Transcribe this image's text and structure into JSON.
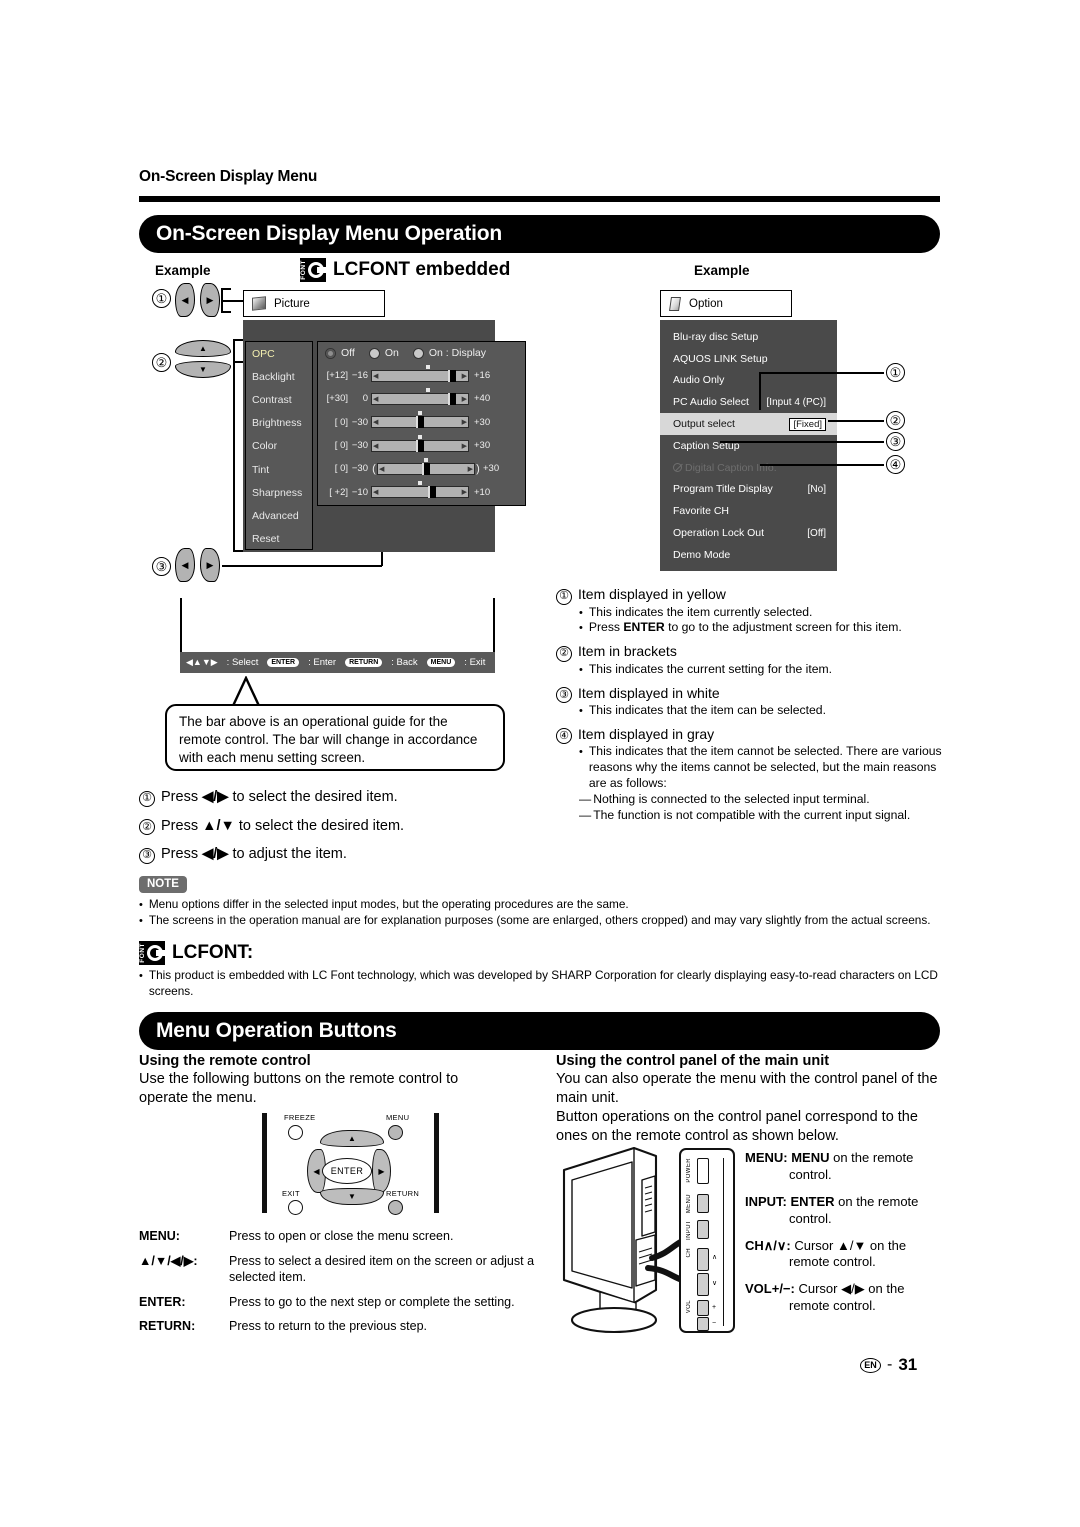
{
  "header": {
    "running_head": "On-Screen Display Menu",
    "band_osd": "On-Screen Display Menu Operation",
    "band_mob": "Menu Operation Buttons"
  },
  "labels": {
    "example_left": "Example",
    "example_right": "Example",
    "lcfont_embedded": "LCFONT embedded",
    "lcfont_mark_text": "FONT",
    "lcfont_heading": "LCFONT:"
  },
  "picture_menu": {
    "tab_label": "Picture",
    "items": [
      {
        "label": "OPC",
        "selected": true
      },
      {
        "label": "Backlight",
        "selected": false
      },
      {
        "label": "Contrast",
        "selected": false
      },
      {
        "label": "Brightness",
        "selected": false
      },
      {
        "label": "Color",
        "selected": false
      },
      {
        "label": "Tint",
        "selected": false
      },
      {
        "label": "Sharpness",
        "selected": false
      },
      {
        "label": "Advanced",
        "selected": false
      },
      {
        "label": "Reset",
        "selected": false
      }
    ],
    "opc_options": [
      {
        "label": "Off",
        "state": "on"
      },
      {
        "label": "On",
        "state": "off"
      },
      {
        "label": "On : Display",
        "state": "off"
      }
    ],
    "sliders": [
      {
        "name": "Backlight",
        "current": "[+12]",
        "min": "−16",
        "max": "+16",
        "pos": 87,
        "paren": false
      },
      {
        "name": "Contrast",
        "current": "[+30]",
        "min": "0",
        "max": "+40",
        "pos": 87,
        "paren": false
      },
      {
        "name": "Brightness",
        "current": "[  0]",
        "min": "−30",
        "max": "+30",
        "pos": 50,
        "paren": false
      },
      {
        "name": "Color",
        "current": "[  0]",
        "min": "−30",
        "max": "+30",
        "pos": 50,
        "paren": false
      },
      {
        "name": "Tint",
        "current": "[  0]",
        "min": "−30",
        "max": "+30",
        "pos": 50,
        "paren": true
      },
      {
        "name": "Sharpness",
        "current": "[ +2]",
        "min": "−10",
        "max": "+10",
        "pos": 62,
        "paren": false
      }
    ]
  },
  "guide_bar": {
    "select_label": ": Select",
    "enter_key": "ENTER",
    "enter_label": ": Enter",
    "return_key": "RETURN",
    "return_label": ": Back",
    "menu_key": "MENU",
    "menu_label": ": Exit"
  },
  "balloon": "The bar above is an operational guide for the remote control. The bar will change in accordance with each menu setting screen.",
  "press_list": [
    {
      "num": "①",
      "text_before": "Press ",
      "keys": "◀/▶",
      "text_after": " to select the desired item."
    },
    {
      "num": "②",
      "text_before": "Press ",
      "keys": "▲/▼",
      "text_after": " to select the desired item."
    },
    {
      "num": "③",
      "text_before": "Press ",
      "keys": "◀/▶",
      "text_after": " to adjust the item."
    }
  ],
  "note": {
    "badge": "NOTE",
    "items": [
      "Menu options differ in the selected input modes, but the operating procedures are the same.",
      "The screens in the operation manual are for explanation purposes (some are enlarged, others cropped) and may vary slightly from the actual screens."
    ]
  },
  "lcfont_note": "This product is embedded with LC Font technology, which was developed by SHARP Corporation for clearly displaying easy-to-read characters on LCD screens.",
  "option_menu": {
    "tab_label": "Option",
    "items": [
      {
        "label": "Blu-ray disc Setup",
        "value": "",
        "style": "normal"
      },
      {
        "label": "AQUOS LINK Setup",
        "value": "",
        "style": "normal"
      },
      {
        "label": "Audio Only",
        "value": "",
        "style": "normal"
      },
      {
        "label": "PC Audio Select",
        "value": "[Input 4 (PC)]",
        "style": "normal"
      },
      {
        "label": "Output select",
        "value": "[Fixed]",
        "style": "selected"
      },
      {
        "label": "Caption Setup",
        "value": "",
        "style": "normal"
      },
      {
        "label": "Digital Caption Info.",
        "value": "",
        "style": "disabled"
      },
      {
        "label": "Program Title Display",
        "value": "[No]",
        "style": "normal"
      },
      {
        "label": "Favorite CH",
        "value": "",
        "style": "normal"
      },
      {
        "label": "Operation Lock Out",
        "value": "[Off]",
        "style": "normal"
      },
      {
        "label": "Demo Mode",
        "value": "",
        "style": "normal"
      }
    ],
    "callout_numbers": [
      "①",
      "②",
      "③",
      "④"
    ]
  },
  "explain": [
    {
      "num": "①",
      "title": "Item displayed in yellow",
      "bullets": [
        "This indicates the item currently selected.",
        "Press ENTER to go to the adjustment screen for this item."
      ],
      "bold_in_bullet": "ENTER",
      "dashes": []
    },
    {
      "num": "②",
      "title": "Item in brackets",
      "bullets": [
        "This indicates the current setting for the item."
      ],
      "dashes": []
    },
    {
      "num": "③",
      "title": "Item displayed in white",
      "bullets": [
        "This indicates that the item can be selected."
      ],
      "dashes": []
    },
    {
      "num": "④",
      "title": "Item displayed in gray",
      "bullets": [
        "This indicates that the item cannot be selected. There are various reasons why the items cannot be selected, but the main reasons are as follows:"
      ],
      "dashes": [
        "Nothing is connected to the selected input terminal.",
        "The function is not compatible with the current input signal."
      ]
    }
  ],
  "remote_section": {
    "heading": "Using the remote control",
    "intro": "Use the following buttons on the remote control to operate the menu.",
    "remote_labels": {
      "freeze": "FREEZE",
      "menu": "MENU",
      "exit": "EXIT",
      "return": "RETURN",
      "enter": "ENTER",
      "up": "▲",
      "down": "▼",
      "left": "◀",
      "right": "▶"
    },
    "keys": [
      {
        "key": "MENU:",
        "desc": "Press to open or close the menu screen."
      },
      {
        "key": "▲/▼/◀/▶:",
        "desc": "Press to select a desired item on the screen or adjust a selected item."
      },
      {
        "key": "ENTER:",
        "desc": "Press to go to the next step or complete the setting."
      },
      {
        "key": "RETURN:",
        "desc": "Press to return to the previous step."
      }
    ]
  },
  "mainunit_section": {
    "heading": "Using the control panel of the main unit",
    "intro": "You can also operate the menu with the control panel of the main unit.",
    "intro2": "Button operations on the control panel correspond to the ones on the remote control as shown below.",
    "panel_labels": [
      "POWER",
      "MENU",
      "INPUT",
      "CH",
      "VOL"
    ],
    "panel_signs": {
      "ch_up": "∧",
      "ch_down": "∨",
      "vol_plus": "+",
      "vol_minus": "−"
    },
    "mapping": [
      {
        "lead": "MENU: MENU",
        "rest": " on the remote",
        "indent": "control."
      },
      {
        "lead": "INPUT: ENTER",
        "rest": " on the remote",
        "indent": "control."
      },
      {
        "lead": "CH∧/∨:",
        "rest": " Cursor ▲/▼ on the",
        "indent": "remote control."
      },
      {
        "lead": "VOL+/−:",
        "rest": " Cursor ◀/▶ on the",
        "indent": "remote control."
      }
    ]
  },
  "footer": {
    "region": "EN",
    "sep": "-",
    "page": "31"
  },
  "colors": {
    "menu_bg": "#4a4a4a",
    "menu_panel": "#585858",
    "selected_row": "#d8d8d8",
    "yellow_item": "#f3efb0",
    "disabled_item": "#6e6e6e",
    "track": "#b2b2b2",
    "note_badge": "#6d6d6d"
  }
}
